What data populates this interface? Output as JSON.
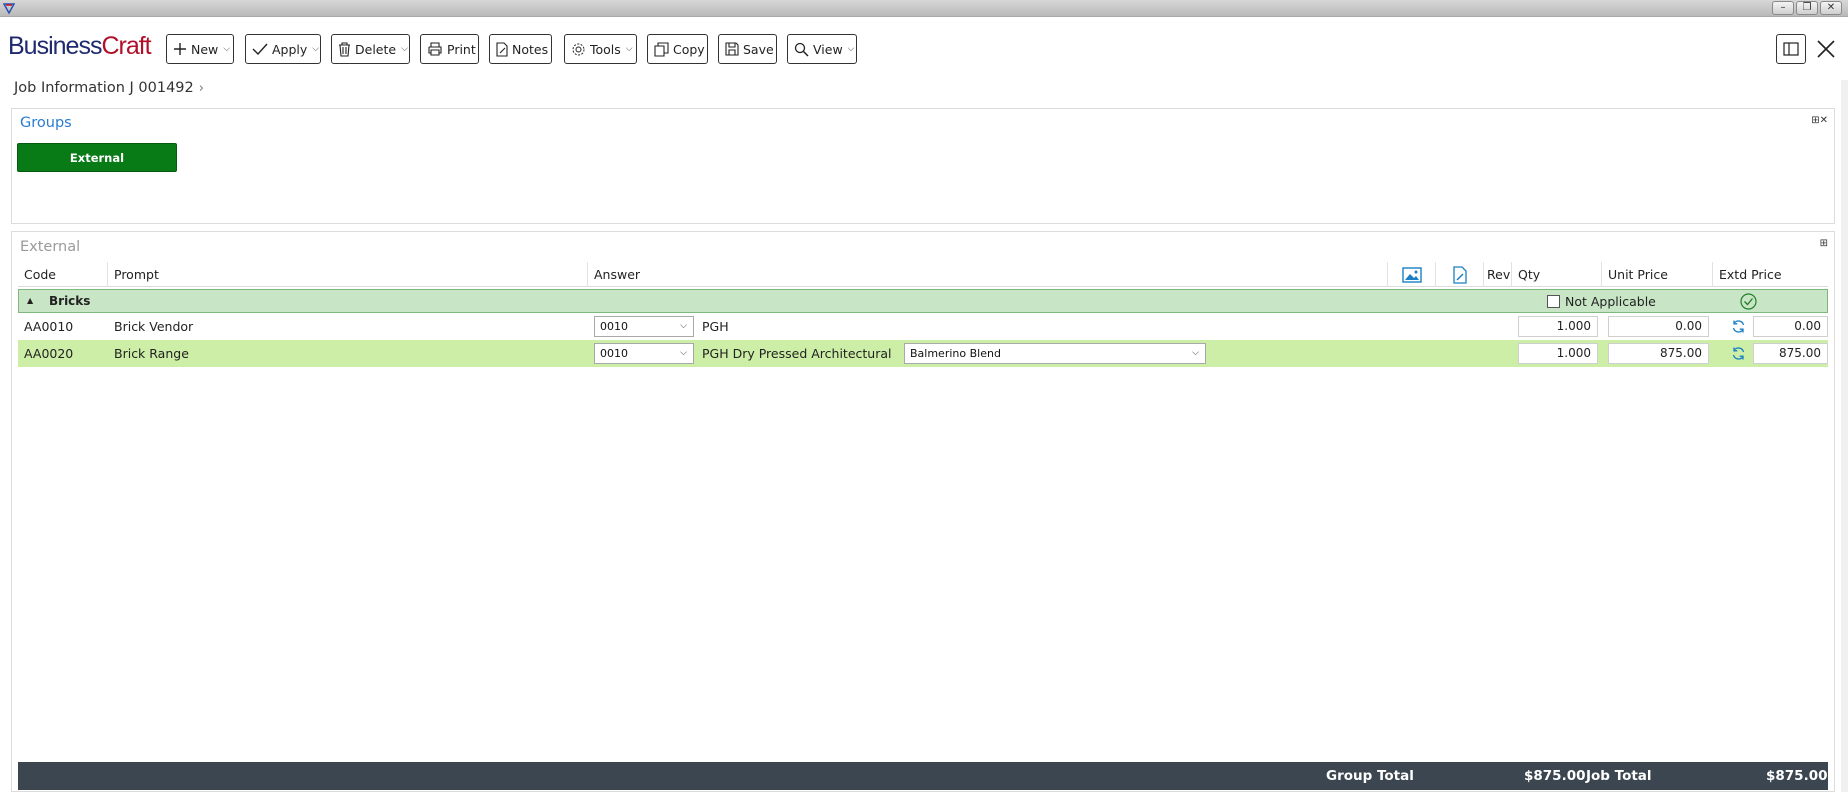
{
  "window": {
    "controls": [
      "minimize-icon",
      "restore-icon",
      "close-icon"
    ]
  },
  "app": {
    "logo_part1": "Business",
    "logo_part2": "Craft",
    "brand_color": "#1f2a6e",
    "brand_accent": "#b0102a"
  },
  "toolbar": {
    "new_label": "New",
    "apply_label": "Apply",
    "delete_label": "Delete",
    "print_label": "Print",
    "notes_label": "Notes",
    "tools_label": "Tools",
    "copy_label": "Copy",
    "save_label": "Save",
    "view_label": "View"
  },
  "breadcrumb": {
    "title": "Job Information J 001492",
    "separator": "›"
  },
  "groups": {
    "title": "Groups",
    "pin_label": "⊞✕",
    "items": [
      {
        "label": "External",
        "color": "#087a16"
      }
    ]
  },
  "external": {
    "title": "External",
    "pin_label": "⊞",
    "columns": {
      "code": "Code",
      "prompt": "Prompt",
      "answer": "Answer",
      "rev": "Rev",
      "qty": "Qty",
      "unit_price": "Unit Price",
      "extd_price": "Extd Price"
    },
    "group_row": {
      "name": "Bricks",
      "not_applicable_label": "Not Applicable",
      "not_applicable_checked": false
    },
    "rows": [
      {
        "code": "AA0010",
        "prompt": "Brick Vendor",
        "answer_code": "0010",
        "answer_text": "PGH",
        "sub_answer": "",
        "qty": "1.000",
        "unit_price": "0.00",
        "extd_price": "0.00",
        "selected": false
      },
      {
        "code": "AA0020",
        "prompt": "Brick Range",
        "answer_code": "0010",
        "answer_text": "PGH Dry Pressed Architectural",
        "sub_answer": "Balmerino Blend",
        "qty": "1.000",
        "unit_price": "875.00",
        "extd_price": "875.00",
        "selected": true
      }
    ]
  },
  "footer": {
    "group_total_label": "Group Total",
    "group_total_value": "$875.00",
    "job_total_label": "Job Total",
    "job_total_value": "$875.00"
  },
  "colors": {
    "group_row_bg": "#c8e6c5",
    "selected_row_bg": "#cdeea7",
    "footer_bg": "#3b4650",
    "link_blue": "#2a7bd1"
  }
}
